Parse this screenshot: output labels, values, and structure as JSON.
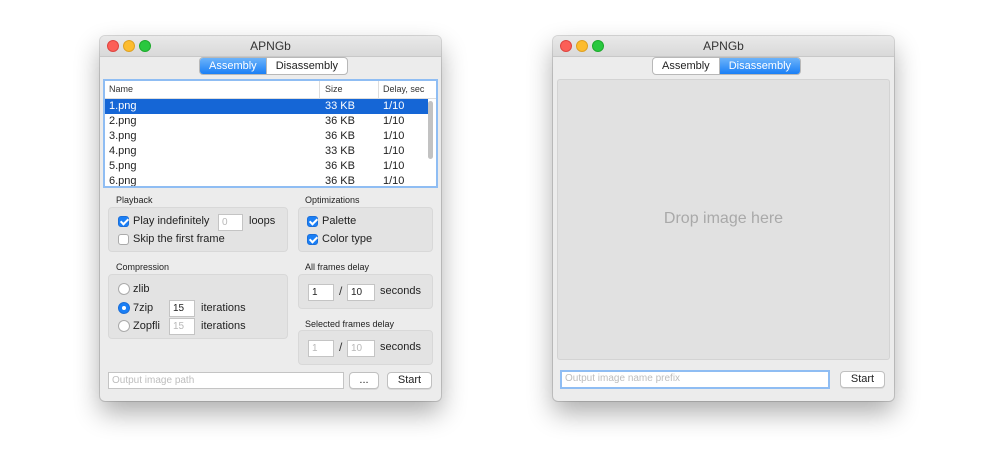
{
  "assembly_window": {
    "title": "APNGb",
    "tabs": [
      {
        "label": "Assembly",
        "active": true
      },
      {
        "label": "Disassembly",
        "active": false
      }
    ],
    "table": {
      "columns": [
        "Name",
        "Size",
        "Delay, sec"
      ],
      "rows": [
        {
          "name": "1.png",
          "size": "33 KB",
          "delay": "1/10",
          "selected": true
        },
        {
          "name": "2.png",
          "size": "36 KB",
          "delay": "1/10",
          "selected": false
        },
        {
          "name": "3.png",
          "size": "36 KB",
          "delay": "1/10",
          "selected": false
        },
        {
          "name": "4.png",
          "size": "33 KB",
          "delay": "1/10",
          "selected": false
        },
        {
          "name": "5.png",
          "size": "36 KB",
          "delay": "1/10",
          "selected": false
        },
        {
          "name": "6.png",
          "size": "36 KB",
          "delay": "1/10",
          "selected": false
        }
      ]
    },
    "playback": {
      "title": "Playback",
      "play_indefinitely": {
        "label": "Play indefinitely",
        "checked": true
      },
      "loops_value": "0",
      "loops_label": "loops",
      "skip_first_frame": {
        "label": "Skip the first frame",
        "checked": false
      }
    },
    "optimizations": {
      "title": "Optimizations",
      "palette": {
        "label": "Palette",
        "checked": true
      },
      "color_type": {
        "label": "Color type",
        "checked": true
      }
    },
    "compression": {
      "title": "Compression",
      "options": [
        {
          "label": "zlib",
          "selected": false,
          "iterations": null
        },
        {
          "label": "7zip",
          "selected": true,
          "iterations": "15"
        },
        {
          "label": "Zopfli",
          "selected": false,
          "iterations": "15"
        }
      ],
      "iterations_label": "iterations"
    },
    "all_frames_delay": {
      "title": "All frames delay",
      "numerator": "1",
      "separator": "/",
      "denominator": "10",
      "unit": "seconds"
    },
    "selected_frames_delay": {
      "title": "Selected frames delay",
      "numerator": "1",
      "separator": "/",
      "denominator": "10",
      "unit": "seconds"
    },
    "output_path_placeholder": "Output image path",
    "browse_label": "...",
    "start_label": "Start"
  },
  "disassembly_window": {
    "title": "APNGb",
    "tabs": [
      {
        "label": "Assembly",
        "active": false
      },
      {
        "label": "Disassembly",
        "active": true
      }
    ],
    "drop_text": "Drop image here",
    "prefix_placeholder": "Output image name prefix",
    "start_label": "Start"
  },
  "colors": {
    "accent": "#1a7ff6",
    "selection": "#1566d6",
    "focus_ring": "#8fbdf3",
    "close": "#fc5f57",
    "minimize": "#fdbc2e",
    "zoom": "#29c83f"
  }
}
